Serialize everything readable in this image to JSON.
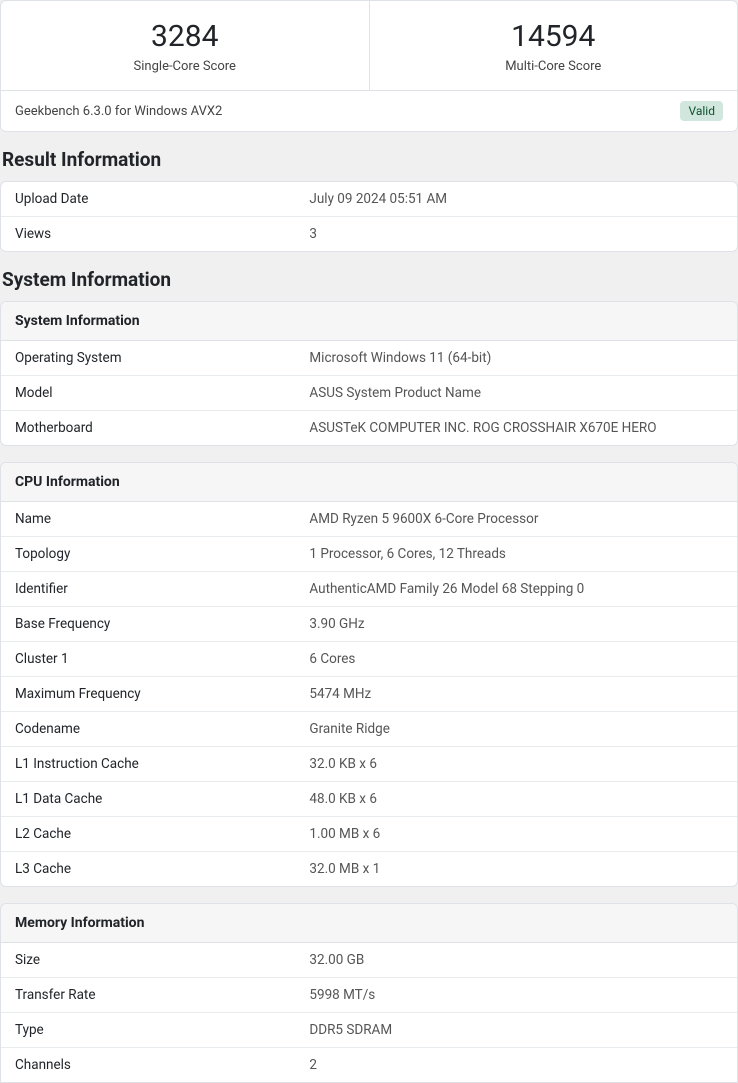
{
  "scores": {
    "single_value": "3284",
    "single_label": "Single-Core Score",
    "multi_value": "14594",
    "multi_label": "Multi-Core Score"
  },
  "version_line": "Geekbench 6.3.0 for Windows AVX2",
  "valid_badge": "Valid",
  "result_info": {
    "heading": "Result Information",
    "rows": [
      {
        "label": "Upload Date",
        "value": "July 09 2024 05:51 AM"
      },
      {
        "label": "Views",
        "value": "3"
      }
    ]
  },
  "system_info_heading": "System Information",
  "system_info": {
    "header": "System Information",
    "rows": [
      {
        "label": "Operating System",
        "value": "Microsoft Windows 11 (64-bit)"
      },
      {
        "label": "Model",
        "value": "ASUS System Product Name"
      },
      {
        "label": "Motherboard",
        "value": "ASUSTeK COMPUTER INC. ROG CROSSHAIR X670E HERO"
      }
    ]
  },
  "cpu_info": {
    "header": "CPU Information",
    "rows": [
      {
        "label": "Name",
        "value": "AMD Ryzen 5 9600X 6-Core Processor"
      },
      {
        "label": "Topology",
        "value": "1 Processor, 6 Cores, 12 Threads"
      },
      {
        "label": "Identifier",
        "value": "AuthenticAMD Family 26 Model 68 Stepping 0"
      },
      {
        "label": "Base Frequency",
        "value": "3.90 GHz"
      },
      {
        "label": "Cluster 1",
        "value": "6 Cores"
      },
      {
        "label": "Maximum Frequency",
        "value": "5474 MHz"
      },
      {
        "label": "Codename",
        "value": "Granite Ridge"
      },
      {
        "label": "L1 Instruction Cache",
        "value": "32.0 KB x 6"
      },
      {
        "label": "L1 Data Cache",
        "value": "48.0 KB x 6"
      },
      {
        "label": "L2 Cache",
        "value": "1.00 MB x 6"
      },
      {
        "label": "L3 Cache",
        "value": "32.0 MB x 1"
      }
    ]
  },
  "memory_info": {
    "header": "Memory Information",
    "rows": [
      {
        "label": "Size",
        "value": "32.00 GB"
      },
      {
        "label": "Transfer Rate",
        "value": "5998 MT/s"
      },
      {
        "label": "Type",
        "value": "DDR5 SDRAM"
      },
      {
        "label": "Channels",
        "value": "2"
      }
    ]
  }
}
